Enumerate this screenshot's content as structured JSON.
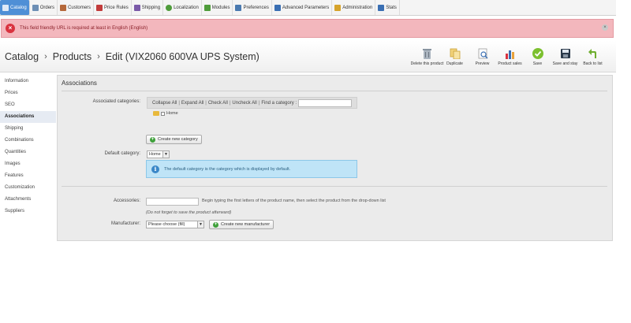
{
  "nav": {
    "tabs": [
      {
        "label": "Catalog",
        "icon": "catalog-icon",
        "color": "#4f8fd6"
      },
      {
        "label": "Orders",
        "icon": "orders-icon",
        "color": "#6d8fb5"
      },
      {
        "label": "Customers",
        "icon": "customers-icon",
        "color": "#b5683a"
      },
      {
        "label": "Price Rules",
        "icon": "price-rules-icon",
        "color": "#c23c3c"
      },
      {
        "label": "Shipping",
        "icon": "shipping-icon",
        "color": "#7a5aa8"
      },
      {
        "label": "Localization",
        "icon": "localization-icon",
        "color": "#4f9c3b"
      },
      {
        "label": "Modules",
        "icon": "modules-icon",
        "color": "#4f9c3b"
      },
      {
        "label": "Preferences",
        "icon": "preferences-icon",
        "color": "#4a7ab0"
      },
      {
        "label": "Advanced Parameters",
        "icon": "advanced-parameters-icon",
        "color": "#3a6fb3"
      },
      {
        "label": "Administration",
        "icon": "administration-icon",
        "color": "#d6a32b"
      },
      {
        "label": "Stats",
        "icon": "stats-icon",
        "color": "#3a6fb3"
      }
    ]
  },
  "error": {
    "text": "This field friendly URL is required at least in English (English)"
  },
  "header": {
    "crumb_catalog": "Catalog",
    "crumb_products": "Products",
    "crumb_edit": "Edit (VIX2060 600VA UPS System)",
    "sep": "›"
  },
  "toolbar": {
    "buttons": [
      {
        "label": "Delete this product",
        "icon": "trash-icon"
      },
      {
        "label": "Duplicate",
        "icon": "duplicate-icon"
      },
      {
        "label": "Preview",
        "icon": "preview-icon"
      },
      {
        "label": "Product sales",
        "icon": "product-sales-icon"
      },
      {
        "label": "Save",
        "icon": "save-check-icon"
      },
      {
        "label": "Save and stay",
        "icon": "save-and-stay-icon"
      },
      {
        "label": "Back to list",
        "icon": "back-arrow-icon"
      }
    ]
  },
  "sidebar": {
    "items": [
      "Information",
      "Prices",
      "SEO",
      "Associations",
      "Shipping",
      "Combinations",
      "Quantities",
      "Images",
      "Features",
      "Customization",
      "Attachments",
      "Suppliers"
    ],
    "active_index": 3
  },
  "panel": {
    "title": "Associations",
    "associated_label": "Associated categories:",
    "collapse_all": "Collapse All",
    "expand_all": "Expand All",
    "check_all": "Check All",
    "uncheck_all": "Uncheck All",
    "pipe": "|",
    "find_label": "Find a category :",
    "tree_home": "Home",
    "create_category": "Create new category",
    "default_category_label": "Default category:",
    "default_category_value": "Home",
    "default_info": "The default category is the category which is displayed by default.",
    "accessories_label": "Accessories:",
    "accessories_hint": "Begin typing the first letters of the product name, then select the product from the drop-down list",
    "accessories_note": "(Do not forget to save the product afterward)",
    "manufacturer_label": "Manufacturer:",
    "manufacturer_value": "Please choose (fill)",
    "create_manufacturer": "Create new manufacturer"
  }
}
